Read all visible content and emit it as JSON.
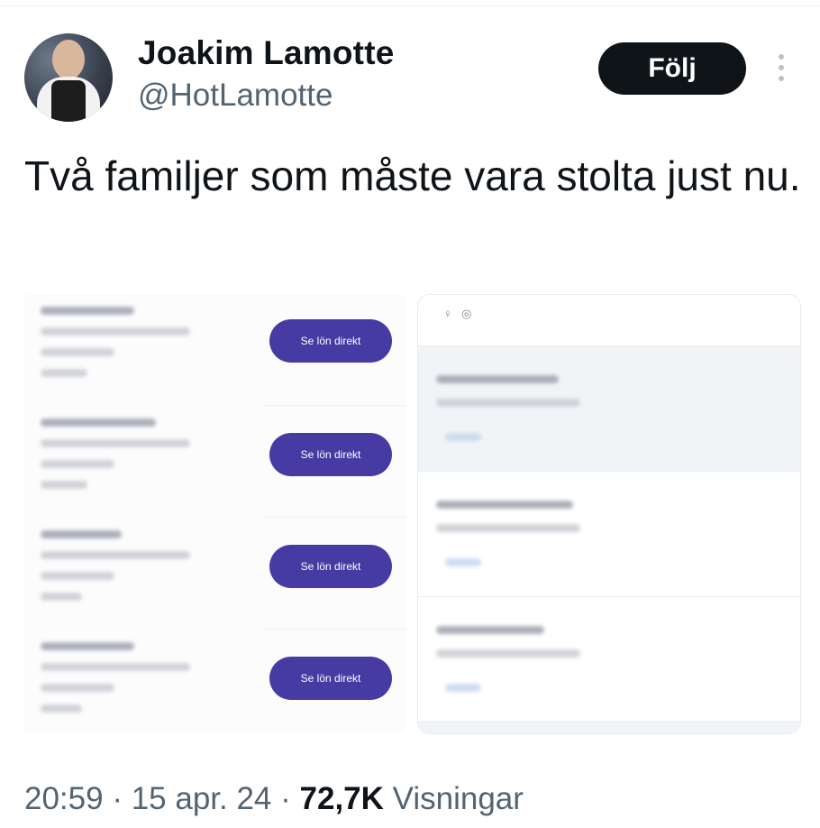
{
  "author": {
    "display_name": "Joakim Lamotte",
    "handle": "@HotLamotte"
  },
  "follow_label": "Följ",
  "more_icon": "more-vertical-icon",
  "tweet": {
    "text": "Två familjer som måste vara stolta just nu."
  },
  "media": {
    "salary_buttons": [
      "Se lön direkt",
      "Se lön direkt",
      "Se lön direkt",
      "Se lön direkt"
    ],
    "right_panel_icons": [
      "female-icon",
      "ring-icon"
    ]
  },
  "meta": {
    "time": "20:59",
    "separator": " · ",
    "date": "15 apr. 24",
    "views_count": "72,7K",
    "views_label": " Visningar"
  },
  "colors": {
    "text": "#0f1419",
    "secondary": "#536471",
    "follow_bg": "#0f1419",
    "salary_button": "#463ba3"
  }
}
